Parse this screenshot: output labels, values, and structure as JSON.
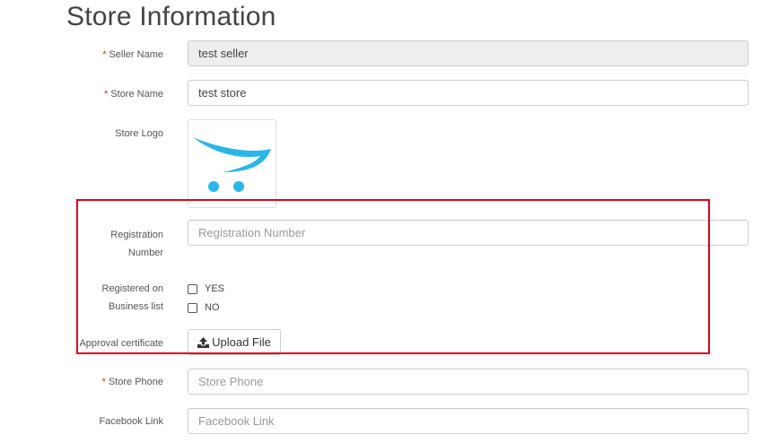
{
  "page": {
    "title": "Store Information"
  },
  "form": {
    "seller_name": {
      "label": "Seller Name",
      "required_mark": "*",
      "value": "test seller"
    },
    "store_name": {
      "label": "Store Name",
      "required_mark": "*",
      "value": "test store"
    },
    "store_logo": {
      "label": "Store Logo",
      "icon": "shopping-cart-logo",
      "colors": {
        "cart": "#29b6e8"
      }
    },
    "registration_number": {
      "label_line1": "Registration",
      "label_line2": "Number",
      "placeholder": "Registration Number"
    },
    "registered_on_business_list": {
      "label_line1": "Registered on",
      "label_line2": "Business list",
      "options": [
        {
          "label": "YES",
          "checked": false
        },
        {
          "label": "NO",
          "checked": false
        }
      ]
    },
    "approval_certificate": {
      "label": "Approval certificate",
      "button_label": "Upload File",
      "icon": "upload-icon"
    },
    "store_phone": {
      "label": "Store Phone",
      "required_mark": "*",
      "placeholder": "Store Phone"
    },
    "facebook_link": {
      "label": "Facebook Link",
      "placeholder": "Facebook Link"
    }
  },
  "colors": {
    "required": "#e2231a",
    "highlight_border": "#e2001a"
  }
}
